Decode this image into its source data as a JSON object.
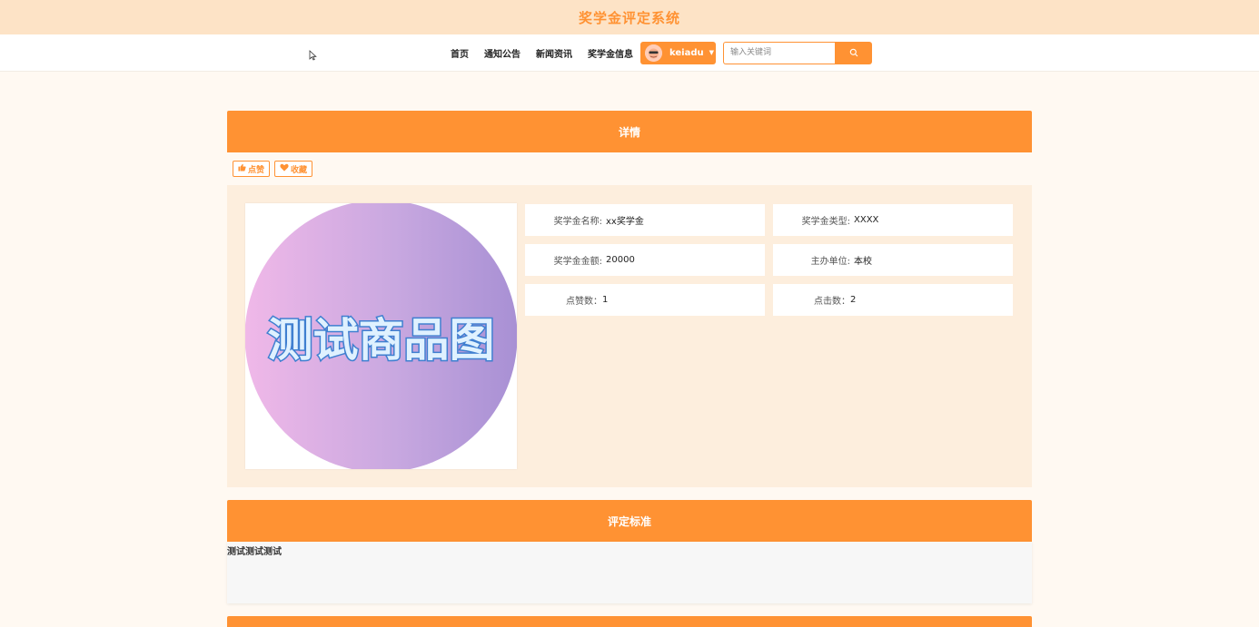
{
  "site": {
    "title": "奖学金评定系统"
  },
  "nav": {
    "items": [
      {
        "label": "首页"
      },
      {
        "label": "通知公告"
      },
      {
        "label": "新闻资讯"
      },
      {
        "label": "奖学金信息"
      }
    ],
    "user": {
      "name": "keiadu"
    },
    "search": {
      "placeholder": "输入关键词",
      "value": ""
    }
  },
  "detail": {
    "header": "详情",
    "actions": {
      "like": "点赞",
      "collect": "收藏"
    },
    "image_text": "测试商品图",
    "fields": [
      {
        "label": "奖学金名称:",
        "value": "xx奖学金"
      },
      {
        "label": "奖学金类型:",
        "value": "XXXX"
      },
      {
        "label": "奖学金金额:",
        "value": "20000"
      },
      {
        "label": "主办单位:",
        "value": "本校"
      },
      {
        "label": "点赞数：",
        "value": "1"
      },
      {
        "label": "点击数：",
        "value": "2"
      }
    ]
  },
  "standard": {
    "header": "评定标准",
    "content": "测试测试测试"
  },
  "colors": {
    "accent": "#ff9233",
    "banner_bg": "#fde3c6",
    "panel_bg": "#fdeedd",
    "page_bg": "#fff9f2"
  },
  "icons": {
    "like": "thumbs-up-icon",
    "collect": "heart-icon",
    "search": "search-icon",
    "caret": "caret-down-icon"
  }
}
